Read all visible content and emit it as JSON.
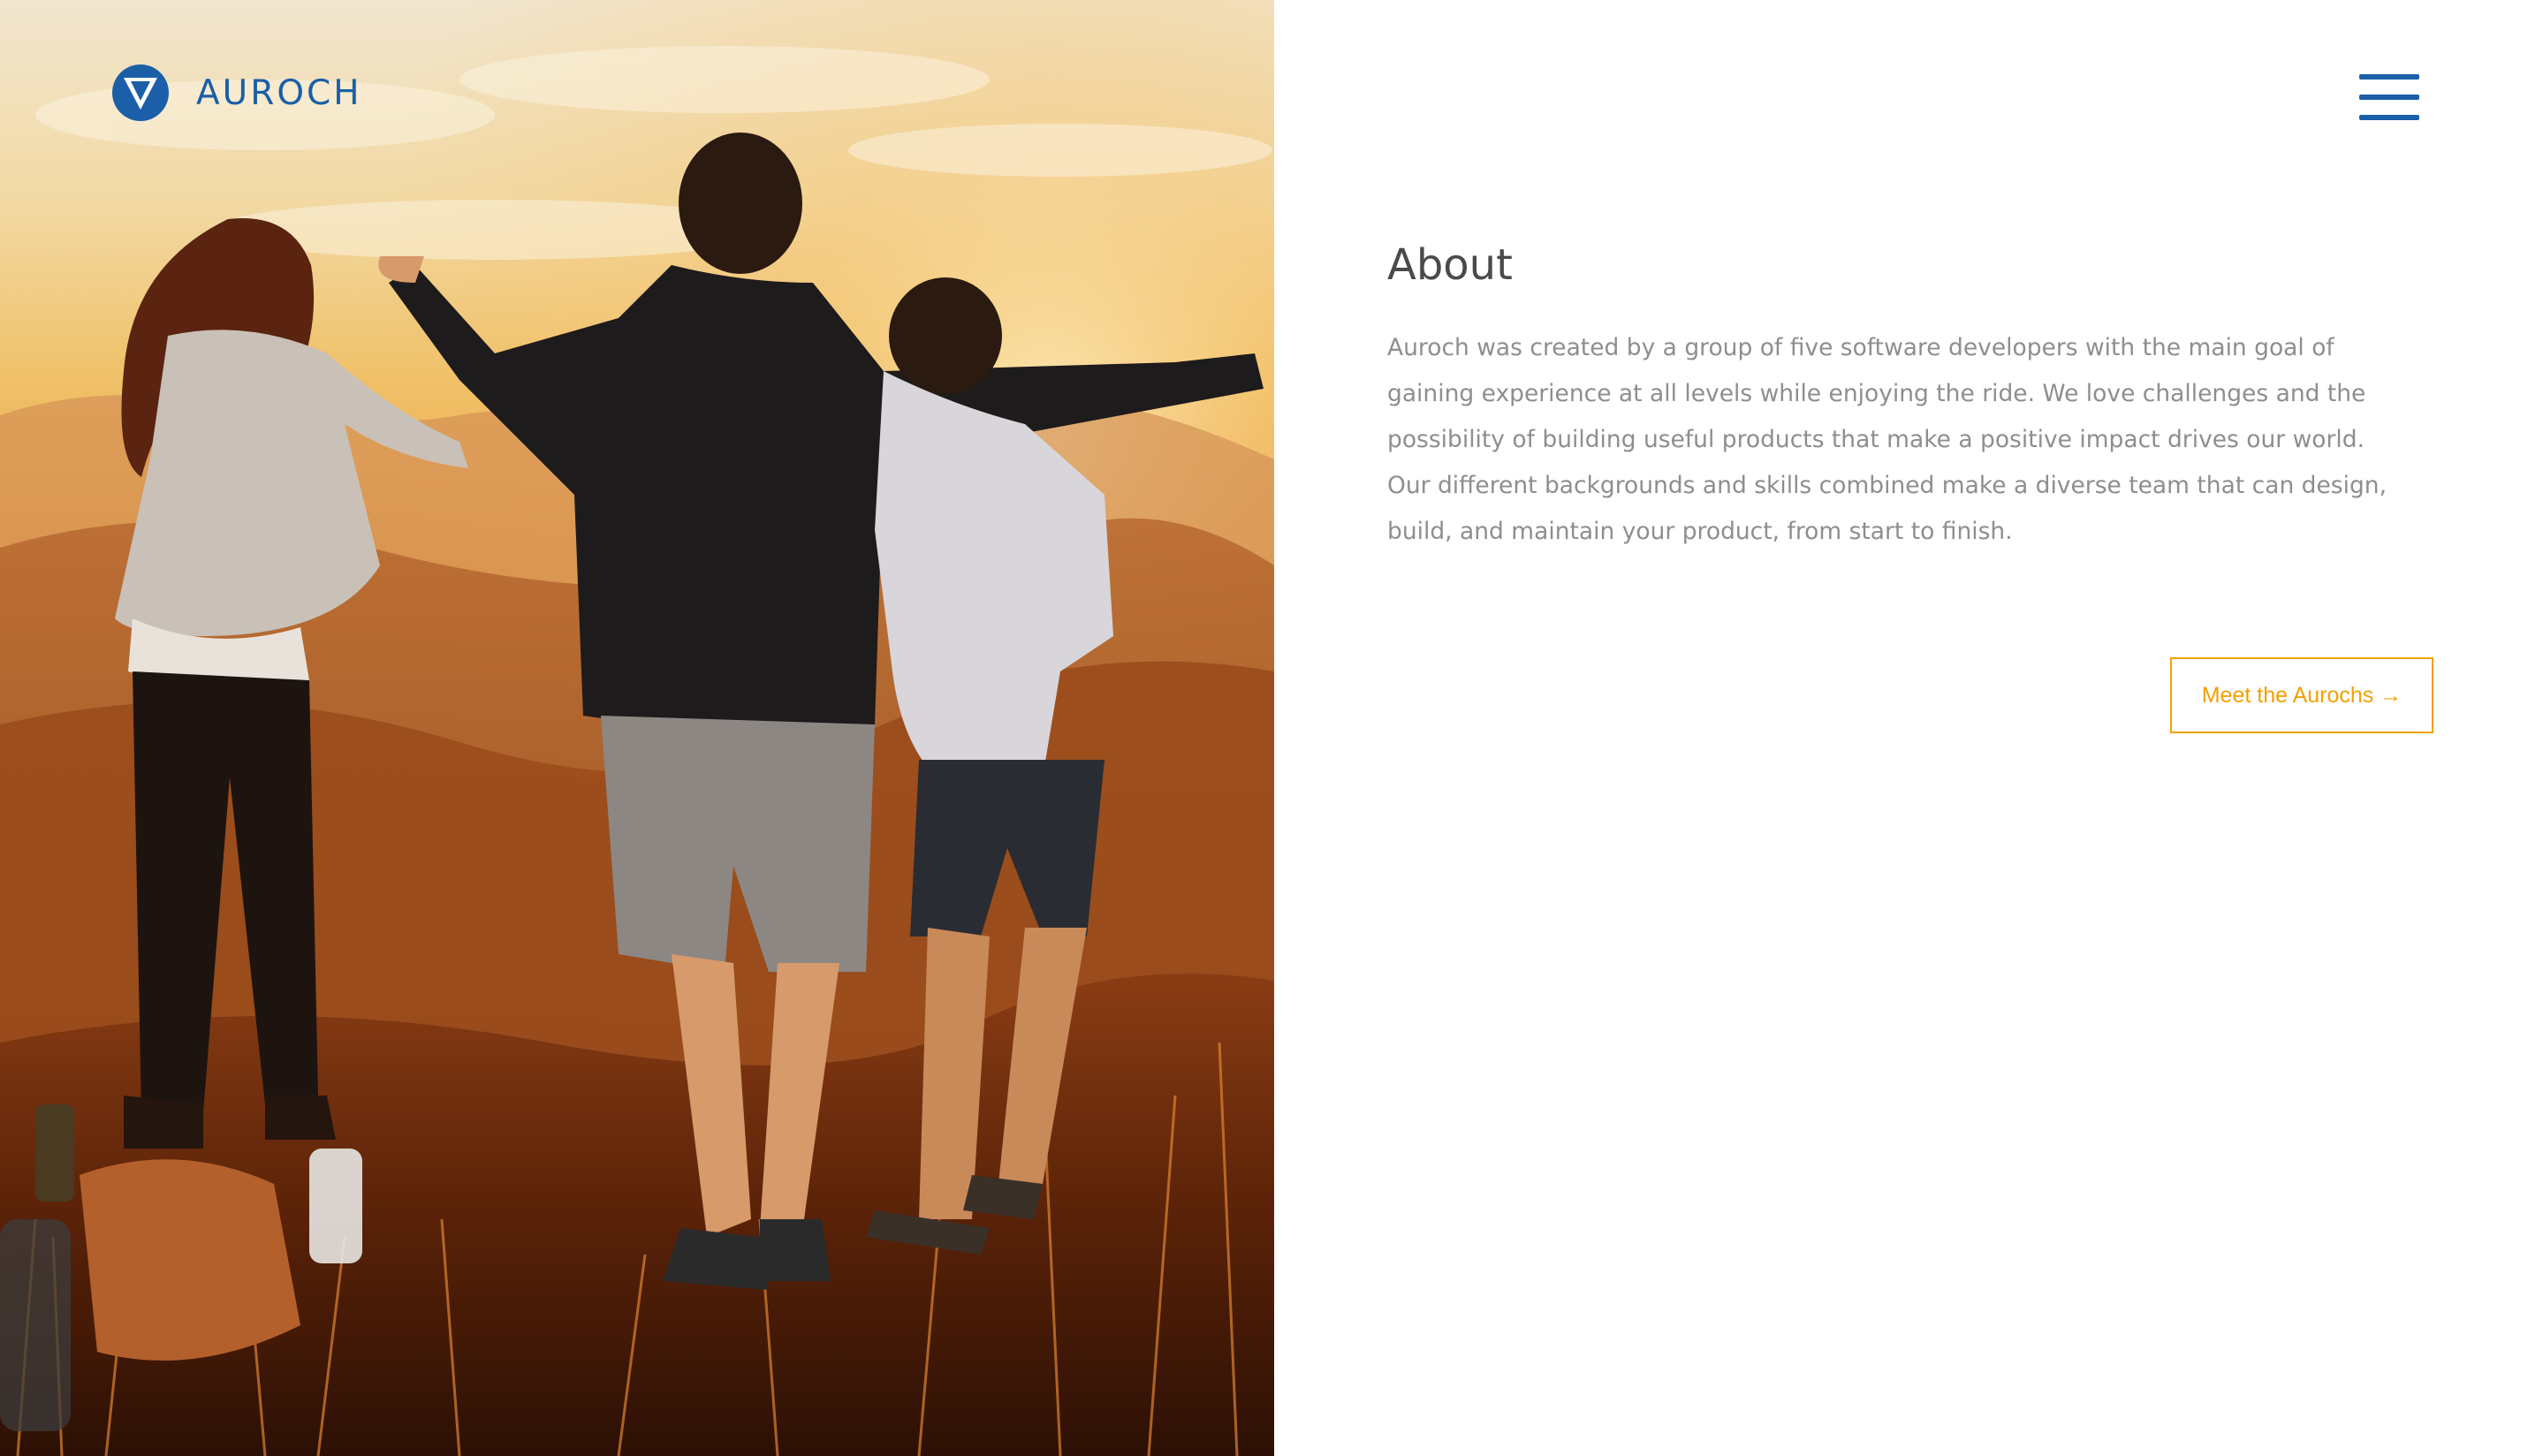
{
  "brand": {
    "name": "AUROCH",
    "logo_icon": "auroch-shield-logo",
    "color": "#1a5fa7"
  },
  "nav": {
    "menu_icon": "hamburger-menu-icon"
  },
  "hero": {
    "image": "photo: group of four friends celebrating on a hilltop at sunset"
  },
  "about": {
    "title": "About",
    "body": "Auroch was created by a group of five software developers with the main goal of gaining experience at all levels while enjoying the ride. We love challenges and the possibility of building useful products that make a positive impact drives our world. Our different backgrounds and skills combined make a diverse team that can design, build, and maintain your product, from start to finish.",
    "cta_label": "Meet the Aurochs →",
    "cta_color": "#f5a000"
  }
}
